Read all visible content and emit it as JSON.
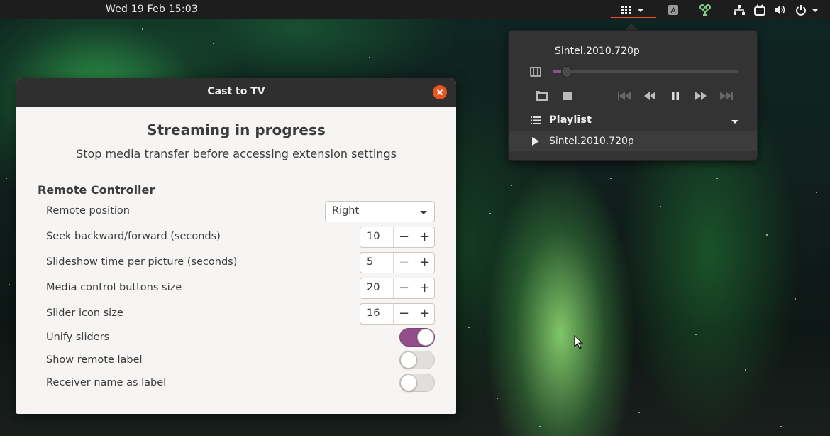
{
  "topbar": {
    "clock": "Wed 19 Feb  15:03",
    "tray_icons": [
      "app-grid-icon",
      "keyboard-layout-icon",
      "extension-icon",
      "network-icon",
      "tv-icon",
      "volume-icon",
      "power-icon"
    ],
    "accent": "#e95420"
  },
  "dialog": {
    "title": "Cast to TV",
    "heading": "Streaming in progress",
    "subheading": "Stop media transfer before accessing extension settings",
    "section": "Remote Controller",
    "rows": {
      "remote_position": {
        "label": "Remote position",
        "value": "Right"
      },
      "seek": {
        "label": "Seek backward/forward (seconds)",
        "value": "10"
      },
      "slideshow": {
        "label": "Slideshow time per picture (seconds)",
        "value": "5"
      },
      "button_size": {
        "label": "Media control buttons size",
        "value": "20"
      },
      "slider_icon_size": {
        "label": "Slider icon size",
        "value": "16"
      },
      "unify_sliders": {
        "label": "Unify sliders",
        "state": "on"
      },
      "show_remote_label": {
        "label": "Show remote label",
        "state": "off"
      },
      "receiver_name_label": {
        "label": "Receiver name as label",
        "state": "off"
      }
    },
    "spin_minus": "−",
    "spin_plus": "+",
    "toggle_accent": "#924d8b"
  },
  "remote": {
    "title": "Sintel.2010.720p",
    "progress": 0.03,
    "controls": [
      "repeat-icon",
      "stop-icon",
      "skip-back-icon",
      "rewind-icon",
      "pause-icon",
      "fast-forward-icon",
      "skip-forward-icon"
    ],
    "playlist_label": "Playlist",
    "playlist_items": [
      "Sintel.2010.720p"
    ]
  }
}
